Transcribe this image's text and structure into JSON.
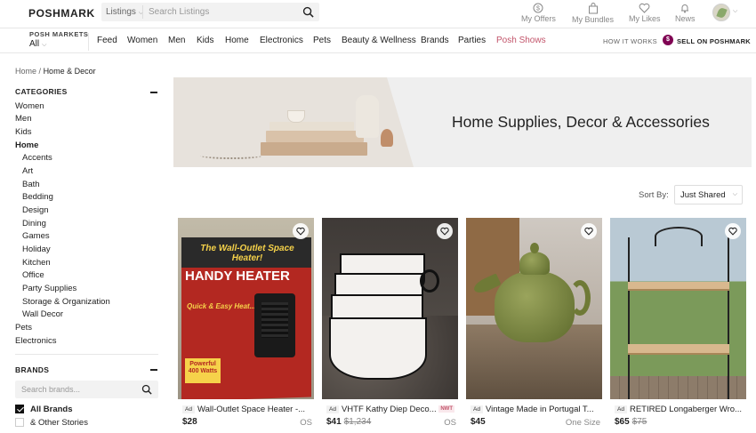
{
  "header": {
    "logo": "POSHMARK",
    "search_scope": "Listings",
    "search_placeholder": "Search Listings",
    "nav": [
      {
        "label": "My Offers"
      },
      {
        "label": "My Bundles"
      },
      {
        "label": "My Likes"
      },
      {
        "label": "News"
      }
    ]
  },
  "mainnav": {
    "posh_markets_label": "POSH MARKETS",
    "posh_markets_value": "All",
    "categories": [
      "Feed",
      "Women",
      "Men",
      "Kids",
      "Home",
      "Electronics",
      "Pets",
      "Beauty & Wellness",
      "Brands",
      "Parties",
      "Posh Shows"
    ],
    "how_it_works": "HOW IT WORKS",
    "sell_badge": "$",
    "sell": "SELL ON POSHMARK",
    "accent_color": "#c2546a",
    "brand_color": "#7f0353"
  },
  "breadcrumb": {
    "home": "Home",
    "sep": "/",
    "current": "Home & Decor"
  },
  "sidebar": {
    "categories_title": "CATEGORIES",
    "top_items": [
      "Women",
      "Men",
      "Kids",
      "Home"
    ],
    "home_sub": [
      "Accents",
      "Art",
      "Bath",
      "Bedding",
      "Design",
      "Dining",
      "Games",
      "Holiday",
      "Kitchen",
      "Office",
      "Party Supplies",
      "Storage & Organization",
      "Wall Decor"
    ],
    "bottom_items": [
      "Pets",
      "Electronics"
    ],
    "brands_title": "BRANDS",
    "brand_search_placeholder": "Search brands...",
    "brands": [
      {
        "label": "All Brands",
        "checked": true
      },
      {
        "label": "& Other Stories",
        "checked": false
      }
    ]
  },
  "banner": {
    "title": "Home Supplies, Decor & Accessories"
  },
  "sort": {
    "label": "Sort By:",
    "value": "Just Shared"
  },
  "listings": [
    {
      "ad": "Ad",
      "title": "Wall-Outlet Space Heater -...",
      "price": "$28",
      "orig": "",
      "size": "OS",
      "nwt": "",
      "box_title": "The Wall-Outlet Space Heater!",
      "box_brand": "HANDY HEATER",
      "box_tagline": "Quick & Easy Heat... Anywhere!",
      "box_badge": "Powerful 400 Watts"
    },
    {
      "ad": "Ad",
      "title": "VHTF Kathy Diep Deco...",
      "price": "$41",
      "orig": "$1,234",
      "size": "OS",
      "nwt": "NWT"
    },
    {
      "ad": "Ad",
      "title": "Vintage Made in Portugal T...",
      "price": "$45",
      "orig": "",
      "size": "One Size",
      "nwt": ""
    },
    {
      "ad": "Ad",
      "title": "RETIRED Longaberger Wro...",
      "price": "$65",
      "orig": "$75",
      "size": "",
      "nwt": ""
    }
  ]
}
